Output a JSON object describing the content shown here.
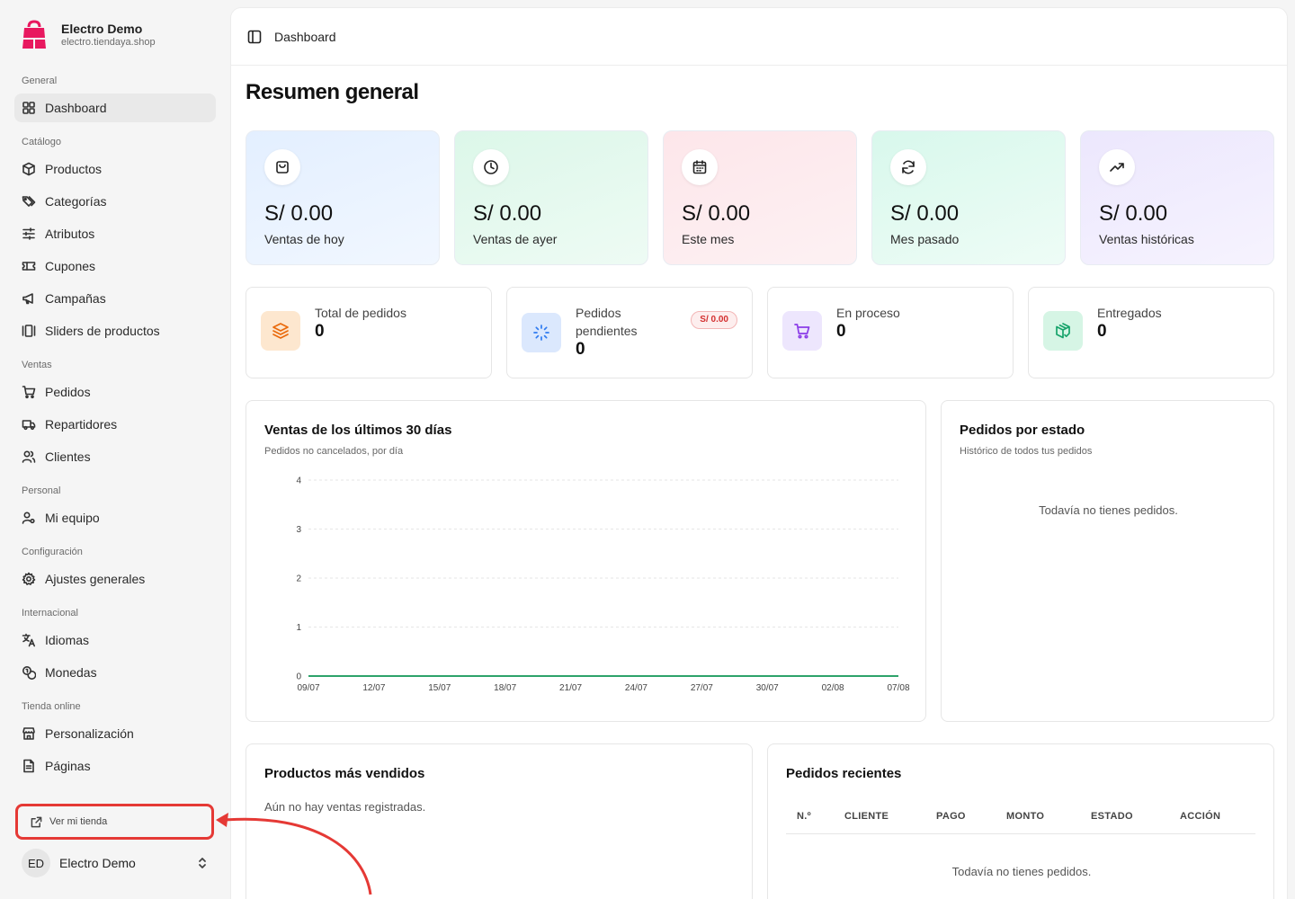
{
  "brand": {
    "name": "Electro Demo",
    "url": "electro.tiendaya.shop"
  },
  "sidebar": {
    "groups": [
      {
        "title": "General",
        "items": [
          {
            "label": "Dashboard",
            "icon": "grid-icon"
          }
        ]
      },
      {
        "title": "Catálogo",
        "items": [
          {
            "label": "Productos",
            "icon": "box-icon"
          },
          {
            "label": "Categorías",
            "icon": "tags-icon"
          },
          {
            "label": "Atributos",
            "icon": "sliders-icon"
          },
          {
            "label": "Cupones",
            "icon": "ticket-icon"
          },
          {
            "label": "Campañas",
            "icon": "megaphone-icon"
          },
          {
            "label": "Sliders de productos",
            "icon": "gallery-icon"
          }
        ]
      },
      {
        "title": "Ventas",
        "items": [
          {
            "label": "Pedidos",
            "icon": "cart-icon"
          },
          {
            "label": "Repartidores",
            "icon": "truck-icon"
          },
          {
            "label": "Clientes",
            "icon": "users-icon"
          }
        ]
      },
      {
        "title": "Personal",
        "items": [
          {
            "label": "Mi equipo",
            "icon": "user-key-icon"
          }
        ]
      },
      {
        "title": "Configuración",
        "items": [
          {
            "label": "Ajustes generales",
            "icon": "gear-icon"
          }
        ]
      },
      {
        "title": "Internacional",
        "items": [
          {
            "label": "Idiomas",
            "icon": "language-icon"
          },
          {
            "label": "Monedas",
            "icon": "coins-icon"
          }
        ]
      },
      {
        "title": "Tienda online",
        "items": [
          {
            "label": "Personalización",
            "icon": "store-icon"
          },
          {
            "label": "Páginas",
            "icon": "file-icon"
          }
        ]
      }
    ],
    "store_link": "Ver mi tienda",
    "user": {
      "initials": "ED",
      "name": "Electro Demo"
    }
  },
  "header": {
    "breadcrumb": "Dashboard"
  },
  "main": {
    "title": "Resumen general",
    "stats": [
      {
        "value": "S/ 0.00",
        "label": "Ventas de hoy",
        "icon": "bag-icon",
        "bg": "#e8f2fe"
      },
      {
        "value": "S/ 0.00",
        "label": "Ventas de ayer",
        "icon": "clock-icon",
        "bg": "#e6f9ef"
      },
      {
        "value": "S/ 0.00",
        "label": "Este mes",
        "icon": "calendar-icon",
        "bg": "#fdeef0"
      },
      {
        "value": "S/ 0.00",
        "label": "Mes pasado",
        "icon": "refresh-icon",
        "bg": "#e4faf2"
      },
      {
        "value": "S/ 0.00",
        "label": "Ventas históricas",
        "icon": "trend-up-icon",
        "bg": "#f1eefd"
      }
    ],
    "orders": [
      {
        "label": "Total de pedidos",
        "value": "0",
        "icon": "layers-icon"
      },
      {
        "label": "Pedidos pendientes",
        "value": "0",
        "badge": "S/ 0.00",
        "icon": "loader-icon"
      },
      {
        "label": "En proceso",
        "value": "0",
        "icon": "cart-icon"
      },
      {
        "label": "Entregados",
        "value": "0",
        "icon": "package-check-icon"
      }
    ],
    "sales_chart": {
      "title": "Ventas de los últimos 30 días",
      "subtitle": "Pedidos no cancelados, por día"
    },
    "status_panel": {
      "title": "Pedidos por estado",
      "subtitle": "Histórico de todos tus pedidos",
      "empty": "Todavía no tienes pedidos."
    },
    "top_products": {
      "title": "Productos más vendidos",
      "empty": "Aún no hay ventas registradas."
    },
    "recent_orders": {
      "title": "Pedidos recientes",
      "columns": [
        "N.º",
        "CLIENTE",
        "PAGO",
        "MONTO",
        "ESTADO",
        "ACCIÓN"
      ],
      "empty": "Todavía no tienes pedidos."
    }
  },
  "colors": {
    "line": "#2ea36b",
    "annotation": "#e53935"
  },
  "chart_data": {
    "type": "line",
    "title": "Ventas de los últimos 30 días",
    "subtitle": "Pedidos no cancelados, por día",
    "xlabel": "",
    "ylabel": "",
    "x_ticks": [
      "09/07",
      "12/07",
      "15/07",
      "18/07",
      "21/07",
      "24/07",
      "27/07",
      "30/07",
      "02/08",
      "07/08"
    ],
    "y_ticks": [
      "0",
      "1",
      "2",
      "3",
      "4"
    ],
    "ylim": [
      0,
      4
    ],
    "series": [
      {
        "values": [
          0,
          0,
          0,
          0,
          0,
          0,
          0,
          0,
          0,
          0
        ]
      }
    ],
    "grid": true,
    "legend": "none"
  }
}
